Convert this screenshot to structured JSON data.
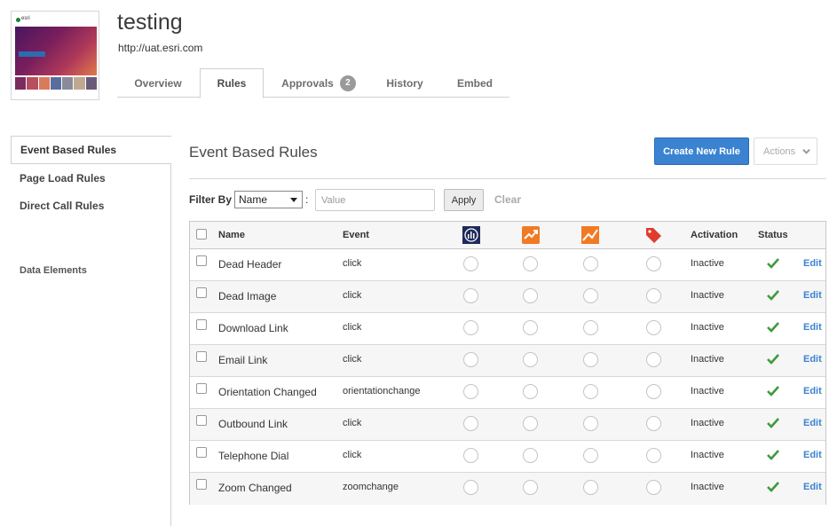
{
  "header": {
    "title": "testing",
    "url": "http://uat.esri.com",
    "thumbnail_logo": "esri",
    "colors": {
      "accent": "#3b83d1",
      "check": "#3c9a3c"
    }
  },
  "tabs": [
    {
      "label": "Overview",
      "active": false
    },
    {
      "label": "Rules",
      "active": true
    },
    {
      "label": "Approvals",
      "active": false,
      "badge": "2"
    },
    {
      "label": "History",
      "active": false
    },
    {
      "label": "Embed",
      "active": false
    }
  ],
  "sidebar": {
    "items": [
      {
        "label": "Event Based Rules",
        "active": true
      },
      {
        "label": "Page Load Rules",
        "active": false
      },
      {
        "label": "Direct Call Rules",
        "active": false
      },
      {
        "label": "Data Elements",
        "active": false
      }
    ]
  },
  "main": {
    "title": "Event Based Rules",
    "create_button": "Create New Rule",
    "actions_button": "Actions",
    "filter": {
      "label": "Filter By",
      "selected": "Name",
      "colon": ":",
      "value_placeholder": "Value",
      "apply": "Apply",
      "clear": "Clear"
    },
    "table": {
      "columns": {
        "name": "Name",
        "event": "Event",
        "tool_icons": [
          "analytics-icon",
          "chart-up-icon",
          "chart-trend-icon",
          "tag-icon"
        ],
        "activation": "Activation",
        "status": "Status"
      },
      "rows": [
        {
          "name": "Dead Header",
          "event": "click",
          "activation": "Inactive",
          "status": "check-icon",
          "edit": "Edit"
        },
        {
          "name": "Dead Image",
          "event": "click",
          "activation": "Inactive",
          "status": "check-icon",
          "edit": "Edit"
        },
        {
          "name": "Download Link",
          "event": "click",
          "activation": "Inactive",
          "status": "check-icon",
          "edit": "Edit"
        },
        {
          "name": "Email Link",
          "event": "click",
          "activation": "Inactive",
          "status": "check-icon",
          "edit": "Edit"
        },
        {
          "name": "Orientation Changed",
          "event": "orientationchange",
          "activation": "Inactive",
          "status": "check-icon",
          "edit": "Edit"
        },
        {
          "name": "Outbound Link",
          "event": "click",
          "activation": "Inactive",
          "status": "check-icon",
          "edit": "Edit"
        },
        {
          "name": "Telephone Dial",
          "event": "click",
          "activation": "Inactive",
          "status": "check-icon",
          "edit": "Edit"
        },
        {
          "name": "Zoom Changed",
          "event": "zoomchange",
          "activation": "Inactive",
          "status": "check-icon",
          "edit": "Edit"
        }
      ]
    }
  }
}
